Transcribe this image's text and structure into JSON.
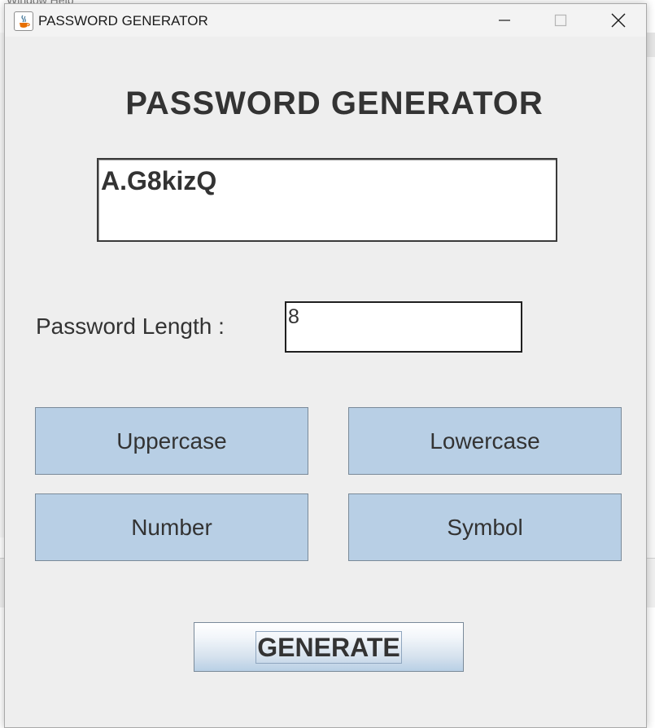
{
  "background": {
    "menu_text": "Window    Help"
  },
  "window": {
    "title": "PASSWORD GENERATOR",
    "icon": "java-cup-icon",
    "controls": {
      "minimize_icon": "minimize-icon",
      "maximize_icon": "maximize-icon",
      "close_icon": "close-icon"
    }
  },
  "main": {
    "heading": "PASSWORD GENERATOR",
    "generated_password": "A.G8kizQ",
    "length_label": "Password Length :",
    "length_value": "8",
    "options": {
      "uppercase": "Uppercase",
      "lowercase": "Lowercase",
      "number": "Number",
      "symbol": "Symbol"
    },
    "generate_label": "GENERATE"
  },
  "colors": {
    "option_button": "#b8cfe5",
    "window_bg": "#eeeeee",
    "text": "#333333"
  }
}
